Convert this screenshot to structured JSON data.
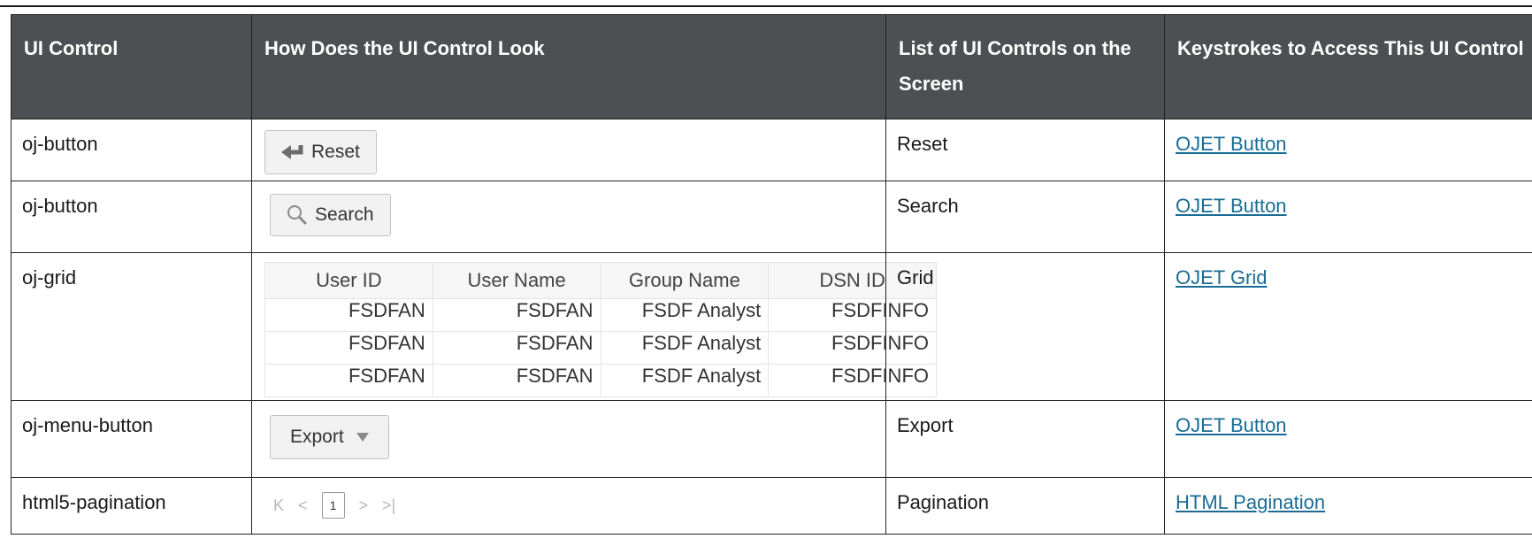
{
  "table": {
    "headers": [
      "UI Control",
      "How Does the UI Control Look",
      "List of UI Controls on the Screen",
      "Keystrokes to Access This UI Control"
    ],
    "rows": [
      {
        "control": "oj-button",
        "preview_label": "Reset",
        "list": "Reset",
        "link": "OJET Button"
      },
      {
        "control": "oj-button",
        "preview_label": "Search",
        "list": "Search",
        "link": "OJET Button"
      },
      {
        "control": "oj-grid",
        "list": "Grid",
        "link": "OJET Grid"
      },
      {
        "control": "oj-menu-button",
        "preview_label": "Export",
        "list": "Export",
        "link": "OJET Button"
      },
      {
        "control": "html5-pagination",
        "list": "Pagination",
        "link": "HTML Pagination"
      }
    ]
  },
  "grid_preview": {
    "columns": [
      "User ID",
      "User Name",
      "Group Name",
      "DSN ID"
    ],
    "rows": [
      [
        "FSDFAN",
        "FSDFAN",
        "FSDF Analyst",
        "FSDFINFO"
      ],
      [
        "FSDFAN",
        "FSDFAN",
        "FSDF Analyst",
        "FSDFINFO"
      ],
      [
        "FSDFAN",
        "FSDFAN",
        "FSDF Analyst",
        "FSDFINFO"
      ]
    ]
  },
  "pagination_preview": {
    "current_page": "1",
    "first_icon": "first-page-icon",
    "prev_icon": "previous-page-icon",
    "next_icon": "next-page-icon",
    "last_icon": "last-page-icon"
  },
  "colors": {
    "header_bg": "#4d4f52",
    "link": "#1a6c94"
  }
}
